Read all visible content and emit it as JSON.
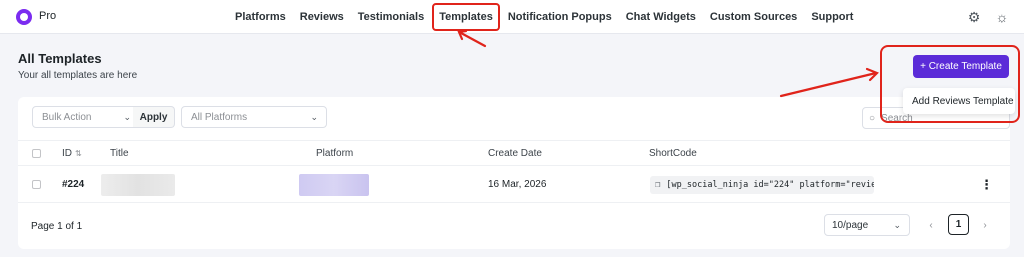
{
  "app": {
    "brand": "Pro"
  },
  "nav": {
    "items": [
      {
        "label": "Platforms"
      },
      {
        "label": "Reviews"
      },
      {
        "label": "Testimonials"
      },
      {
        "label": "Templates"
      },
      {
        "label": "Notification Popups"
      },
      {
        "label": "Chat Widgets"
      },
      {
        "label": "Custom Sources"
      },
      {
        "label": "Support"
      }
    ],
    "active": "Templates",
    "icons": [
      "gear-icon",
      "sun-icon"
    ]
  },
  "header": {
    "title": "All Templates",
    "subtitle": "Your all templates are here",
    "create_button": "+ Create Template",
    "dropdown_item": "Add Reviews Template"
  },
  "filters": {
    "bulk_action_placeholder": "Bulk Action",
    "apply_label": "Apply",
    "platforms_placeholder": "All Platforms",
    "search_placeholder": "Search"
  },
  "table": {
    "columns": [
      "ID",
      "Title",
      "Platform",
      "Create Date",
      "ShortCode"
    ],
    "rows": [
      {
        "id": "#224",
        "create_date": "16 Mar, 2026",
        "shortcode": "[wp_social_ninja id=\"224\" platform=\"revie…"
      }
    ]
  },
  "pagination": {
    "page_info": "Page 1 of 1",
    "per_page": "10/page",
    "current_page": "1"
  },
  "colors": {
    "primary": "#5b2bd8",
    "annotation": "#e0241b",
    "background": "#f4f5f9"
  }
}
